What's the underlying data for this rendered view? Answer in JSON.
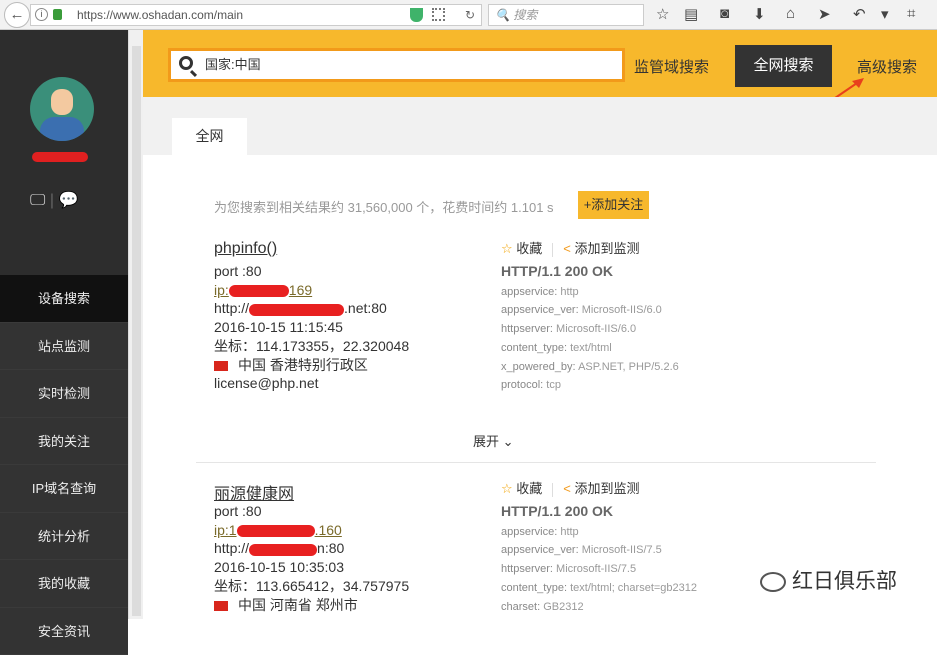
{
  "browser": {
    "url": "https://www.oshadan.com/main",
    "search_placeholder": "搜索"
  },
  "sidebar": {
    "items": [
      {
        "label": "设备搜索",
        "active": true
      },
      {
        "label": "站点监测"
      },
      {
        "label": "实时检测"
      },
      {
        "label": "我的关注"
      },
      {
        "label": "IP域名查询"
      },
      {
        "label": "统计分析"
      },
      {
        "label": "我的收藏"
      },
      {
        "label": "安全资讯"
      }
    ]
  },
  "header": {
    "search_value": "国家:中国",
    "domain_search": "监管域搜索",
    "all_search": "全网搜索",
    "advanced_search": "高级搜索",
    "accent": "#f7b82c"
  },
  "tabs": [
    {
      "label": "全网"
    }
  ],
  "summary": {
    "text": "为您搜索到相关结果约 31,560,000 个，花费时间约 1.101 s",
    "follow": "+添加关注"
  },
  "actions": {
    "favorite": "收藏",
    "monitor": "添加到监测",
    "expand": "展开"
  },
  "results": [
    {
      "title": "phpinfo()",
      "port": "port :80",
      "ip_prefix": "ip:",
      "ip_suffix": "169",
      "url_prefix": "http://",
      "url_suffix": ".net:80",
      "time": "2016-10-15 11:15:45",
      "coords": "坐标：114.173355，22.320048",
      "location": "中国 香港特别行政区",
      "extra": "license@php.net",
      "status": "HTTP/1.1 200 OK",
      "fields": [
        {
          "k": "appservice:",
          "v": "http"
        },
        {
          "k": "appservice_ver:",
          "v": "Microsoft-IIS/6.0"
        },
        {
          "k": "httpserver:",
          "v": "Microsoft-IIS/6.0"
        },
        {
          "k": "content_type:",
          "v": "text/html"
        },
        {
          "k": "x_powered_by:",
          "v": "ASP.NET, PHP/5.2.6"
        },
        {
          "k": "protocol:",
          "v": "tcp"
        }
      ]
    },
    {
      "title": "丽源健康网",
      "port": "port :80",
      "ip_prefix": "ip:1",
      "ip_suffix": ".160",
      "url_prefix": "http://",
      "url_suffix": "n:80",
      "time": "2016-10-15 10:35:03",
      "coords": "坐标：113.665412，34.757975",
      "location": "中国 河南省 郑州市",
      "status": "HTTP/1.1 200 OK",
      "fields": [
        {
          "k": "appservice:",
          "v": "http"
        },
        {
          "k": "appservice_ver:",
          "v": "Microsoft-IIS/7.5"
        },
        {
          "k": "httpserver:",
          "v": "Microsoft-IIS/7.5"
        },
        {
          "k": "content_type:",
          "v": "text/html; charset=gb2312"
        },
        {
          "k": "charset:",
          "v": "GB2312"
        }
      ]
    }
  ],
  "watermark": "红日俱乐部"
}
